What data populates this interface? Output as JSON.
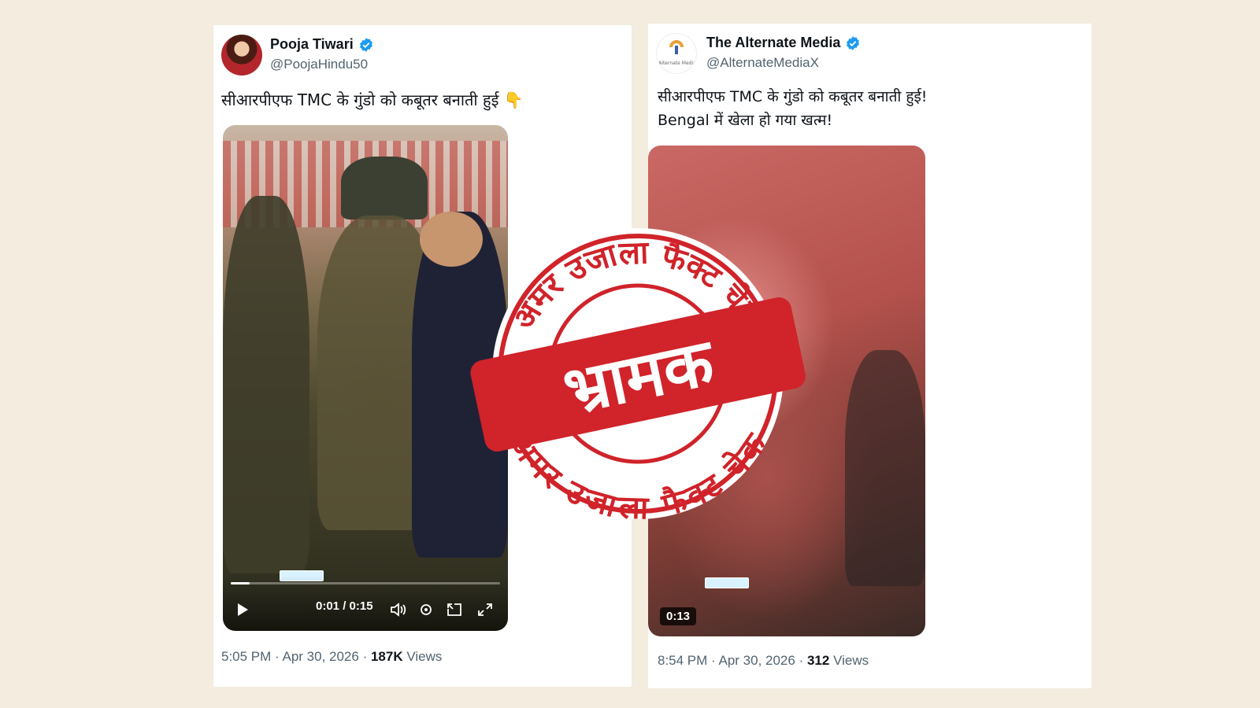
{
  "tweets": [
    {
      "display_name": "Pooja Tiwari",
      "handle": "@PoojaHindu50",
      "text": "सीआरपीएफ TMC के गुंडो को कबूतर बनाती हुई 👇",
      "video": {
        "current_time": "0:01",
        "duration": "0:15",
        "progress": 0.07
      },
      "time": "5:05 PM",
      "date": "Apr 30, 2026",
      "views_count": "187K",
      "views_label": "Views"
    },
    {
      "display_name": "The Alternate Media",
      "handle": "@AlternateMediaX",
      "avatar_text": "Alternate Media",
      "text_line1": "सीआरपीएफ TMC के गुंडो को कबूतर बनाती हुई!",
      "text_line2": "Bengal में खेला हो गया खत्म!",
      "video": {
        "duration_badge": "0:13"
      },
      "time": "8:54 PM",
      "date": "Apr 30, 2026",
      "views_count": "312",
      "views_label": "Views"
    }
  ],
  "stamp": {
    "ring_text_top": "अमर उजाला फैक्ट चेक",
    "ring_text_bottom": "अमर उजाला फैक्ट चेक",
    "verdict": "भ्रामक",
    "color": "#d0232a"
  },
  "colors": {
    "background": "#f3ecdf",
    "verified": "#1d9bf0",
    "muted": "#536471"
  },
  "icons": [
    "verified-badge-icon",
    "play-icon",
    "volume-icon",
    "settings-icon",
    "pip-icon",
    "fullscreen-icon"
  ]
}
